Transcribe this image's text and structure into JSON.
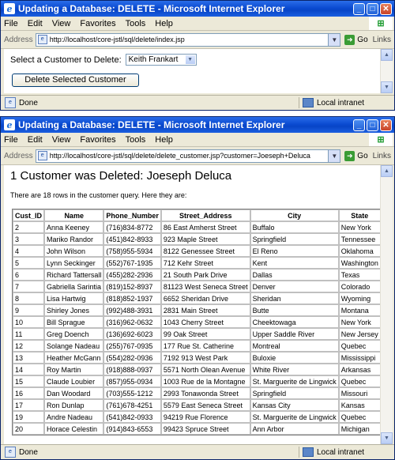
{
  "windows": [
    {
      "title": "Updating a Database: DELETE - Microsoft Internet Explorer",
      "menu": [
        "File",
        "Edit",
        "View",
        "Favorites",
        "Tools",
        "Help"
      ],
      "address_label": "Address",
      "url": "http://localhost/core-jstl/sql/delete/index.jsp",
      "go_label": "Go",
      "links_label": "Links",
      "status": "Done",
      "zone": "Local intranet"
    },
    {
      "title": "Updating a Database: DELETE - Microsoft Internet Explorer",
      "menu": [
        "File",
        "Edit",
        "View",
        "Favorites",
        "Tools",
        "Help"
      ],
      "address_label": "Address",
      "url": "http://localhost/core-jstl/sql/delete/delete_customer.jsp?customer=Joeseph+Deluca",
      "go_label": "Go",
      "links_label": "Links",
      "status": "Done",
      "zone": "Local intranet"
    }
  ],
  "page1": {
    "select_label": "Select a Customer to Delete:",
    "selected_customer": "Keith Frankart",
    "delete_button": "Delete Selected Customer"
  },
  "page2": {
    "heading": "1 Customer was Deleted: Joeseph Deluca",
    "info": "There are 18 rows in the customer query. Here they are:",
    "columns": [
      "Cust_ID",
      "Name",
      "Phone_Number",
      "Street_Address",
      "City",
      "State"
    ],
    "rows": [
      [
        "2",
        "Anna Keeney",
        "(716)834-8772",
        "86 East Amherst Street",
        "Buffalo",
        "New York"
      ],
      [
        "3",
        "Mariko Randor",
        "(451)842-8933",
        "923 Maple Street",
        "Springfield",
        "Tennessee"
      ],
      [
        "4",
        "John Wilson",
        "(758)955-5934",
        "8122 Genessee Street",
        "El Reno",
        "Oklahoma"
      ],
      [
        "5",
        "Lynn Seckinger",
        "(552)767-1935",
        "712 Kehr Street",
        "Kent",
        "Washington"
      ],
      [
        "6",
        "Richard Tattersall",
        "(455)282-2936",
        "21 South Park Drive",
        "Dallas",
        "Texas"
      ],
      [
        "7",
        "Gabriella Sarintia",
        "(819)152-8937",
        "81123 West Seneca Street",
        "Denver",
        "Colorado"
      ],
      [
        "8",
        "Lisa Hartwig",
        "(818)852-1937",
        "6652 Sheridan Drive",
        "Sheridan",
        "Wyoming"
      ],
      [
        "9",
        "Shirley Jones",
        "(992)488-3931",
        "2831 Main Street",
        "Butte",
        "Montana"
      ],
      [
        "10",
        "Bill Sprague",
        "(316)962-0632",
        "1043 Cherry Street",
        "Cheektowaga",
        "New York"
      ],
      [
        "11",
        "Greg Doench",
        "(136)692-6023",
        "99 Oak Street",
        "Upper Saddle River",
        "New Jersey"
      ],
      [
        "12",
        "Solange Nadeau",
        "(255)767-0935",
        "177 Rue St. Catherine",
        "Montreal",
        "Quebec"
      ],
      [
        "13",
        "Heather McGann",
        "(554)282-0936",
        "7192 913 West Park",
        "Buloxie",
        "Mississippi"
      ],
      [
        "14",
        "Roy Martin",
        "(918)888-0937",
        "5571 North Olean Avenue",
        "White River",
        "Arkansas"
      ],
      [
        "15",
        "Claude Loubier",
        "(857)955-0934",
        "1003 Rue de la Montagne",
        "St. Marguerite de Lingwick",
        "Quebec"
      ],
      [
        "16",
        "Dan Woodard",
        "(703)555-1212",
        "2993 Tonawonda Street",
        "Springfield",
        "Missouri"
      ],
      [
        "17",
        "Ron Dunlap",
        "(761)678-4251",
        "5579 East Seneca Street",
        "Kansas City",
        "Kansas"
      ],
      [
        "19",
        "Andre Nadeau",
        "(541)842-0933",
        "94219 Rue Florence",
        "St. Marguerite de Lingwick",
        "Quebec"
      ],
      [
        "20",
        "Horace Celestin",
        "(914)843-6553",
        "99423 Spruce Street",
        "Ann Arbor",
        "Michigan"
      ]
    ]
  }
}
